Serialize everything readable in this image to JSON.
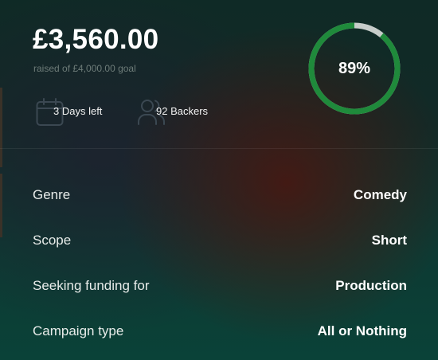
{
  "campaign": {
    "amount_raised": "£3,560.00",
    "goal_text": "raised of £4,000.00 goal",
    "progress": {
      "percent_label": "89%",
      "fraction": 0.89,
      "fill_color": "#1f8a3b",
      "track_color": "#c7cdca"
    },
    "stats": {
      "days_left": "3 Days left",
      "backers": "92 Backers"
    }
  },
  "details": [
    {
      "label": "Genre",
      "value": "Comedy"
    },
    {
      "label": "Scope",
      "value": "Short"
    },
    {
      "label": "Seeking funding for",
      "value": "Production"
    },
    {
      "label": "Campaign type",
      "value": "All or Nothing"
    }
  ],
  "icons": {
    "days": "calendar-icon",
    "backers": "users-icon"
  }
}
